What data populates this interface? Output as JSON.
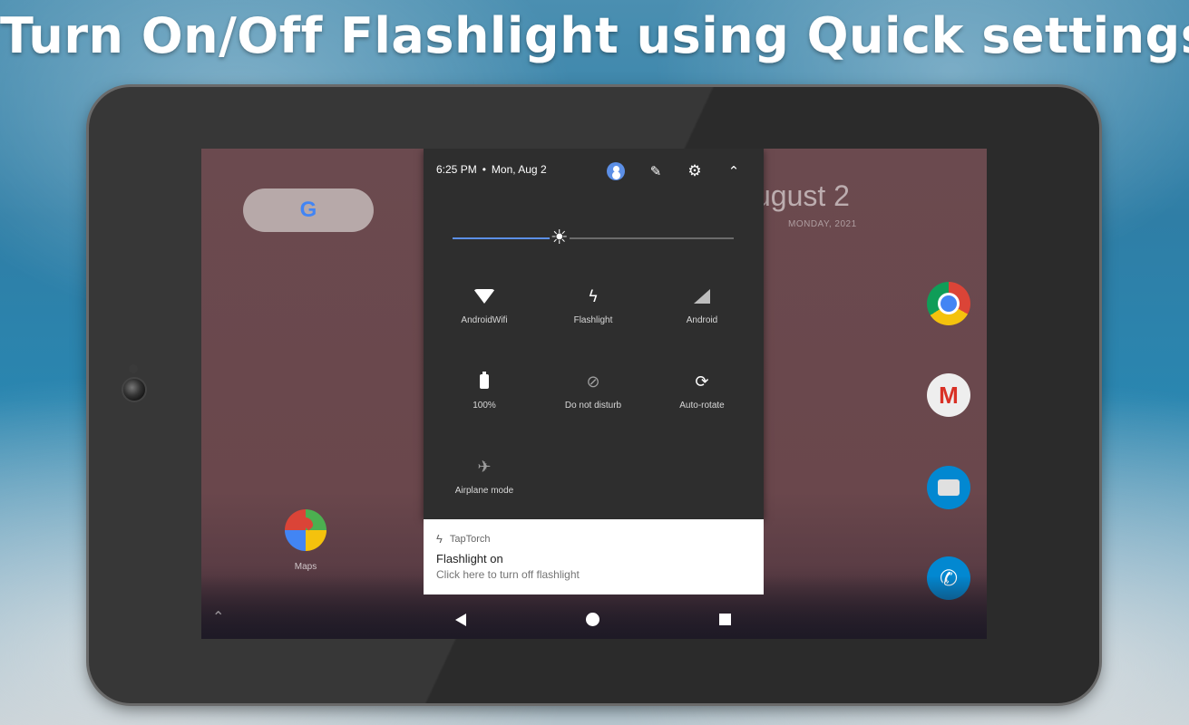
{
  "banner": {
    "title": "Turn On/Off Flashlight using Quick settings"
  },
  "homescreen": {
    "search_logo": "G",
    "date_big": "ugust 2",
    "date_small": "MONDAY, 2021",
    "apps": [
      {
        "label": "Maps",
        "icon": "maps-icon"
      }
    ],
    "dock": [
      "chrome-icon",
      "gmail-icon",
      "messages-icon",
      "phone-icon"
    ],
    "gmail_glyph": "M",
    "phone_glyph": "✆"
  },
  "quick_settings": {
    "time": "6:25 PM",
    "separator": "•",
    "date": "Mon, Aug 2",
    "header_icons": [
      "user-icon",
      "pencil-icon",
      "gear-icon",
      "chevron-up-icon"
    ],
    "pencil_glyph": "✎",
    "gear_glyph": "⚙",
    "collapse_glyph": "⌃",
    "brightness": {
      "level": 0.38,
      "icon": "brightness-icon",
      "glyph": "☀"
    },
    "tiles": [
      {
        "label": "AndroidWifi",
        "icon": "wifi-icon",
        "glyph": ""
      },
      {
        "label": "Flashlight",
        "icon": "flashlight-icon",
        "glyph": "ϟ"
      },
      {
        "label": "Android",
        "icon": "cellular-signal-icon",
        "glyph": ""
      },
      {
        "label": "100%",
        "icon": "battery-icon",
        "glyph": ""
      },
      {
        "label": "Do not disturb",
        "icon": "do-not-disturb-icon",
        "glyph": "⊘"
      },
      {
        "label": "Auto-rotate",
        "icon": "auto-rotate-icon",
        "glyph": "⟳"
      },
      {
        "label": "Airplane mode",
        "icon": "airplane-icon",
        "glyph": "✈"
      }
    ]
  },
  "notification": {
    "app": "TapTorch",
    "bolt_glyph": "ϟ",
    "title": "Flashlight on",
    "text": "Click here to turn off flashlight"
  },
  "navbar": {
    "up_glyph": "⌃"
  },
  "colors": {
    "accent": "#5c8fe6",
    "panel": "#2e2e2e",
    "wallpaper": "#6b4a4f"
  }
}
